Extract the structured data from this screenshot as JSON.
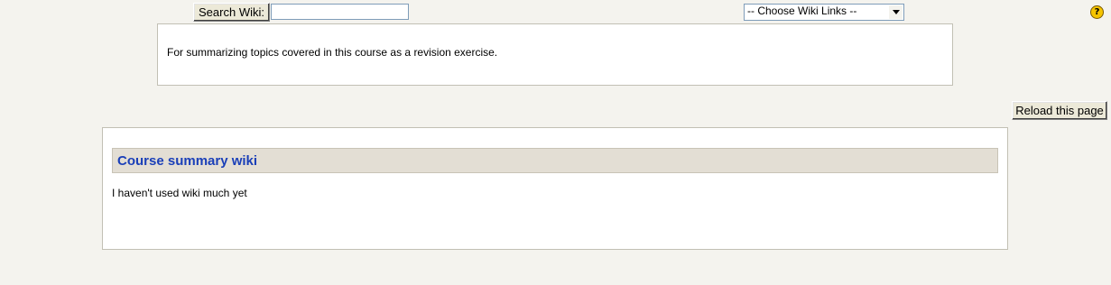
{
  "search": {
    "button_label": "Search Wiki:",
    "input_value": ""
  },
  "wiki_links": {
    "selected": "-- Choose Wiki Links --"
  },
  "help": {
    "icon": "help-icon",
    "glyph": "?"
  },
  "summary": {
    "text": "For summarizing topics covered in this course as a revision exercise."
  },
  "reload": {
    "label": "Reload this page"
  },
  "wiki_page": {
    "title": "Course summary wiki",
    "body": "I haven't used wiki much yet"
  },
  "colors": {
    "page_bg": "#f4f3ee",
    "heading_bg": "#e3ded4",
    "heading_text": "#1a3fb8",
    "border": "#c2c0b4"
  }
}
